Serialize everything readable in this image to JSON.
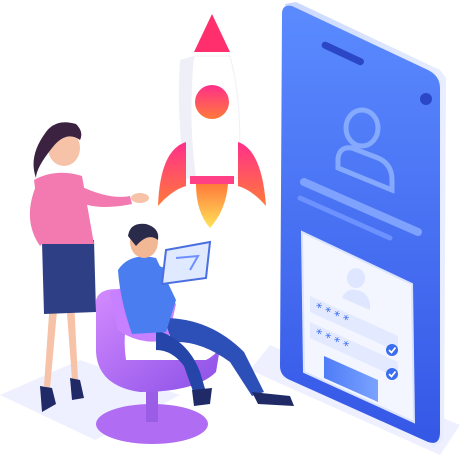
{
  "illustration": {
    "subject": "isometric-app-launch",
    "password_fields": [
      {
        "mask": "* * * *",
        "checked": true
      },
      {
        "mask": "* * * *",
        "checked": true
      }
    ],
    "colors": {
      "phone_blue": "#3c6ff5",
      "phone_light": "#8fb2ff",
      "accent_pink": "#ff4aa0",
      "rocket_flame": "#ffd23a",
      "chair_purple": "#b06cf2",
      "woman_top": "#f27ab0",
      "woman_skirt": "#2f3f86",
      "man_shirt": "#4a7df0",
      "man_pants": "#2d4fb8",
      "floor": "#e9ecff"
    }
  }
}
